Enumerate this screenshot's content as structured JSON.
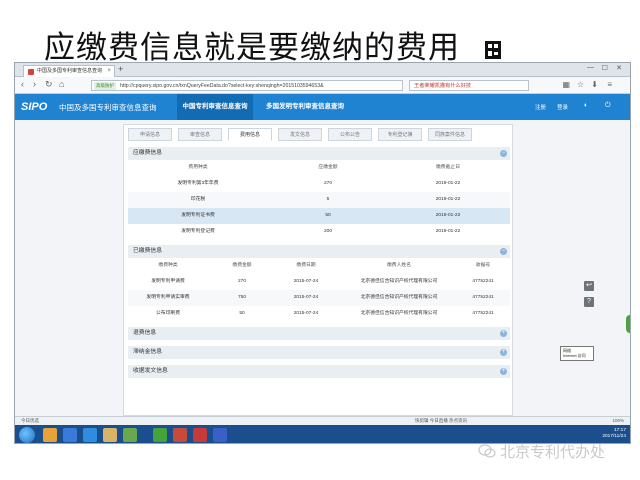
{
  "slide": {
    "title": "应缴费信息就是要缴纳的费用",
    "watermark": "北京专利代办处"
  },
  "browser": {
    "tab_title": "中国及多国专利审查信息查询",
    "tab_close": "×",
    "new_tab": "+",
    "security_badge": "高级防护",
    "url": "http://cpquery.sipo.gov.cn/txnQueryFeeData.do?select-key:shenqingh=2015103594653&",
    "search_text": "王者荣耀凯撒有什么好技",
    "status_text": "今日优选",
    "status_right": "快剪辑   今日直播   热点资讯",
    "zoom": "100%"
  },
  "header": {
    "logo": "SIPO",
    "site_name": "中国及多国专利审查信息查询",
    "nav_active": "中国专利审查信息查询",
    "nav_other": "多国发明专利审查信息查询",
    "link_register": "注册",
    "link_login": "登录"
  },
  "tabs": [
    "申请信息",
    "审查信息",
    "费用信息",
    "发文信息",
    "公布公告",
    "专利登记簿",
    "同族案件信息"
  ],
  "due_fees": {
    "title": "应缴费信息",
    "columns": [
      "费用种类",
      "应缴金额",
      "缴费截止日"
    ],
    "rows": [
      [
        "发明专利第3年年费",
        "270",
        "2018-01-22"
      ],
      [
        "印花税",
        "5",
        "2018-01-22"
      ],
      [
        "发明专利证书费",
        "50",
        "2018-01-22"
      ],
      [
        "发明专利登记费",
        "200",
        "2018-01-22"
      ]
    ]
  },
  "paid_fees": {
    "title": "已缴费信息",
    "columns": [
      "缴费种类",
      "缴费金额",
      "缴费日期",
      "缴费人姓名",
      "收据号"
    ],
    "rows": [
      [
        "发明专利申请费",
        "270",
        "2015-07-24",
        "北京德佳信合知识产权代理有限公司",
        "47752241"
      ],
      [
        "发明专利申请实审费",
        "750",
        "2015-07-24",
        "北京德佳信合知识产权代理有限公司",
        "47752241"
      ],
      [
        "公布印刷费",
        "50",
        "2015-07-24",
        "北京德佳信合知识产权代理有限公司",
        "47752241"
      ]
    ]
  },
  "sections": {
    "refund": "退费信息",
    "late_fee": "滞纳金信息",
    "receipt_docs": "收据发文信息"
  },
  "taskbar": {
    "time": "17:17",
    "date": "2017/11/24",
    "tooltip_line1": "网络",
    "tooltip_line2": "Internet 访问"
  },
  "colors": {
    "header_blue": "#1f83d2",
    "nav_active_bg": "#136cb3",
    "selected_row": "#d7e7f4",
    "taskbar": "#1b4e8c"
  }
}
